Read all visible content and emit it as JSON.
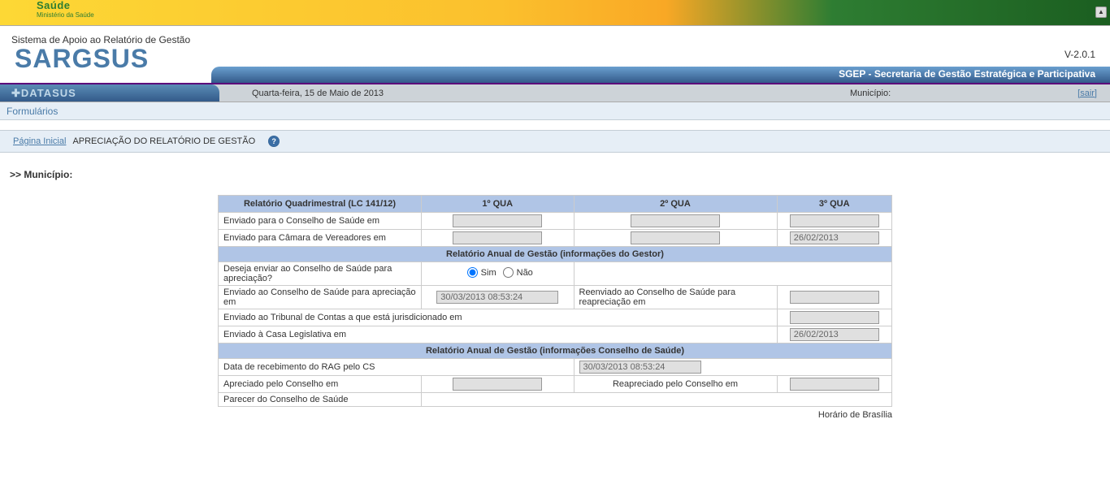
{
  "header": {
    "ministry_top": "Saúde",
    "ministry_sub": "Ministério da Saúde",
    "system_line": "Sistema de Apoio ao Relatório de Gestão",
    "system_name": "SARGSUS",
    "version": "V-2.0.1",
    "sgep": "SGEP - Secretaria de Gestão Estratégica e Participativa",
    "datasus": "DATASUS",
    "date": "Quarta-feira, 15 de Maio de 2013",
    "municipio_label": "Município:",
    "sair": "[sair]"
  },
  "menu": {
    "formularios": "Formulários"
  },
  "breadcrumb": {
    "home": "Página Inicial",
    "title": "APRECIAÇÃO DO RELATÓRIO DE GESTÃO"
  },
  "page": {
    "municipio_prefix": ">> Município:"
  },
  "table": {
    "hdr_quad": "Relatório Quadrimestral (LC 141/12)",
    "q1": "1º QUA",
    "q2": "2º QUA",
    "q3": "3º QUA",
    "row_env_conselho": "Enviado para o Conselho de Saúde em",
    "row_env_camara": "Enviado para Câmara de Vereadores em",
    "camara_q3": "26/02/2013",
    "section_gestor": "Relatório Anual de Gestão (informações do Gestor)",
    "row_deseja": "Deseja enviar ao Conselho de Saúde para apreciação?",
    "opt_sim": "Sim",
    "opt_nao": "Não",
    "row_env_apreciacao": "Enviado ao Conselho de Saúde para apreciação em",
    "env_apreciacao_val": "30/03/2013 08:53:24",
    "row_reenviado": "Reenviado ao Conselho de Saúde para reapreciação em",
    "row_tribunal": "Enviado ao Tribunal de Contas a que está jurisdicionado em",
    "row_casa_leg": "Enviado à Casa Legislativa em",
    "casa_leg_val": "26/02/2013",
    "section_conselho": "Relatório Anual de Gestão (informações Conselho de Saúde)",
    "row_data_receb": "Data de recebimento do RAG pelo CS",
    "data_receb_val": "30/03/2013 08:53:24",
    "row_apreciado": "Apreciado pelo Conselho em",
    "row_reapreciado": "Reapreciado pelo Conselho em",
    "row_parecer": "Parecer do Conselho de Saúde"
  },
  "footer": {
    "horario": "Horário de Brasília"
  }
}
